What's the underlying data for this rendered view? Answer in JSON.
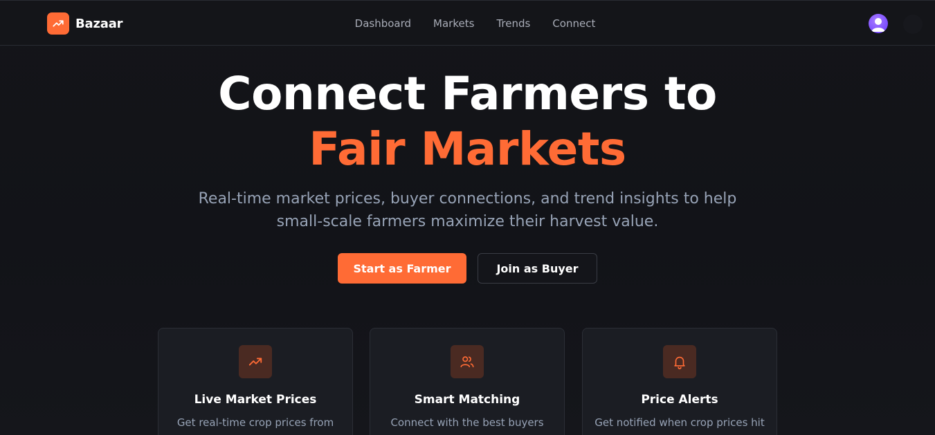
{
  "brand": {
    "name": "Bazaar",
    "logo_icon": "trending-up-icon",
    "accent": "#ff6b35"
  },
  "nav": {
    "items": [
      "Dashboard",
      "Markets",
      "Trends",
      "Connect"
    ]
  },
  "hero": {
    "title_line1": "Connect Farmers to",
    "title_line2": "Fair Markets",
    "subtitle_line1": "Real-time market prices, buyer connections, and trend insights to help",
    "subtitle_line2": "small-scale farmers maximize their harvest value."
  },
  "buttons": {
    "primary": "Start as Farmer",
    "secondary": "Join as Buyer"
  },
  "features": [
    {
      "icon": "trending-up-icon",
      "title": "Live Market Prices",
      "desc": "Get real-time crop prices from"
    },
    {
      "icon": "users-icon",
      "title": "Smart Matching",
      "desc": "Connect with the best buyers"
    },
    {
      "icon": "bell-icon",
      "title": "Price Alerts",
      "desc": "Get notified when crop prices hit"
    }
  ],
  "colors": {
    "background": "#121318",
    "accent": "#ff6b35",
    "muted_text": "#97a3b6",
    "avatar": "#7b4dff"
  }
}
